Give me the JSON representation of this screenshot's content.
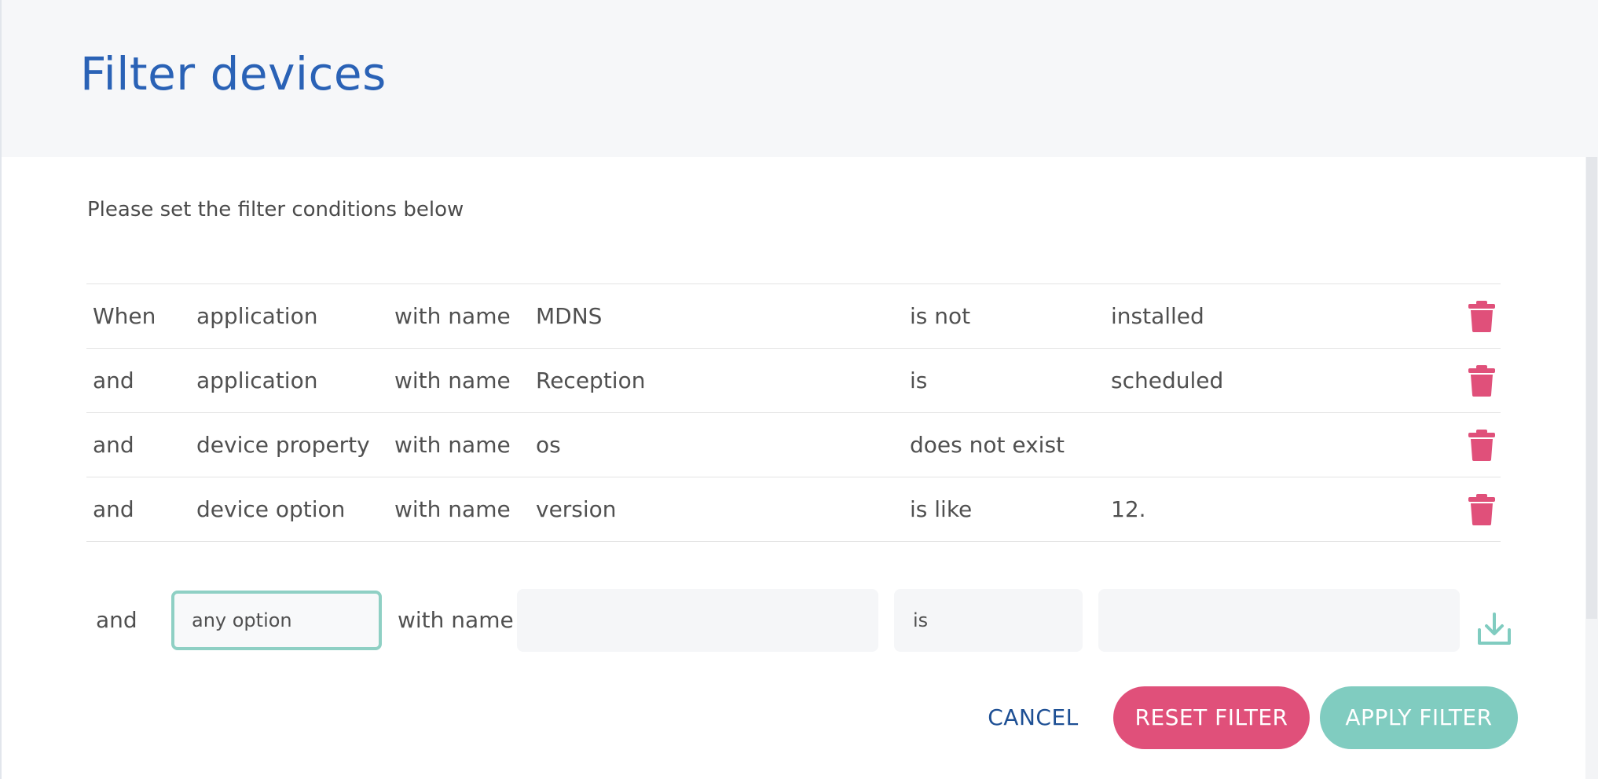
{
  "dialog": {
    "title": "Filter devices",
    "subtitle": "Please set the filter conditions below"
  },
  "conditions": [
    {
      "conjunction": "When",
      "type": "application",
      "with": "with name",
      "name": "MDNS",
      "operator": "is not",
      "value": "installed"
    },
    {
      "conjunction": "and",
      "type": "application",
      "with": "with name",
      "name": "Reception",
      "operator": "is",
      "value": "scheduled"
    },
    {
      "conjunction": "and",
      "type": "device property",
      "with": "with name",
      "name": "os",
      "operator": "does not exist",
      "value": ""
    },
    {
      "conjunction": "and",
      "type": "device option",
      "with": "with name",
      "name": "version",
      "operator": "is like",
      "value": "12."
    }
  ],
  "new_condition": {
    "conjunction": "and",
    "type": "any option",
    "with": "with name",
    "name": "",
    "operator": "is",
    "value": ""
  },
  "buttons": {
    "cancel": "CANCEL",
    "reset": "RESET FILTER",
    "apply": "APPLY FILTER"
  },
  "icons": {
    "delete": "trash-icon",
    "save": "download-icon"
  },
  "colors": {
    "title": "#2a62b6",
    "delete": "#e0507a",
    "accent": "#80ccc0",
    "cancel": "#1d4f94"
  }
}
